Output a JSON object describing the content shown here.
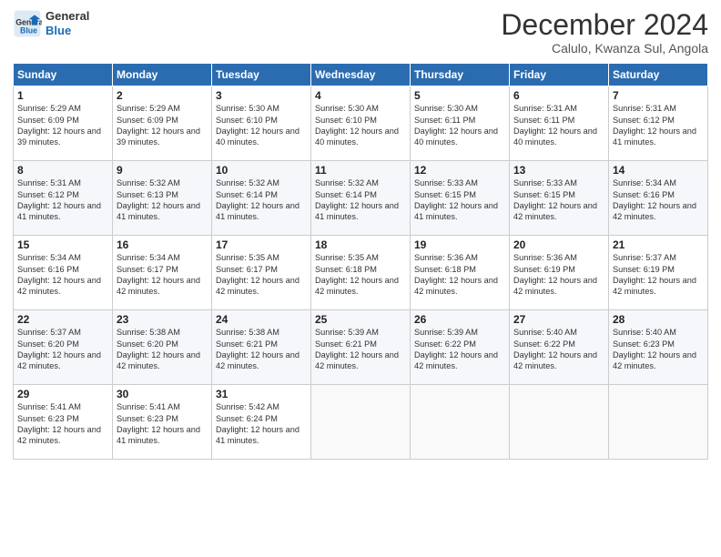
{
  "logo": {
    "line1": "General",
    "line2": "Blue"
  },
  "title": "December 2024",
  "subtitle": "Calulo, Kwanza Sul, Angola",
  "days_header": [
    "Sunday",
    "Monday",
    "Tuesday",
    "Wednesday",
    "Thursday",
    "Friday",
    "Saturday"
  ],
  "weeks": [
    [
      {
        "day": "1",
        "sunrise": "5:29 AM",
        "sunset": "6:09 PM",
        "daylight": "12 hours and 39 minutes."
      },
      {
        "day": "2",
        "sunrise": "5:29 AM",
        "sunset": "6:09 PM",
        "daylight": "12 hours and 39 minutes."
      },
      {
        "day": "3",
        "sunrise": "5:30 AM",
        "sunset": "6:10 PM",
        "daylight": "12 hours and 40 minutes."
      },
      {
        "day": "4",
        "sunrise": "5:30 AM",
        "sunset": "6:10 PM",
        "daylight": "12 hours and 40 minutes."
      },
      {
        "day": "5",
        "sunrise": "5:30 AM",
        "sunset": "6:11 PM",
        "daylight": "12 hours and 40 minutes."
      },
      {
        "day": "6",
        "sunrise": "5:31 AM",
        "sunset": "6:11 PM",
        "daylight": "12 hours and 40 minutes."
      },
      {
        "day": "7",
        "sunrise": "5:31 AM",
        "sunset": "6:12 PM",
        "daylight": "12 hours and 41 minutes."
      }
    ],
    [
      {
        "day": "8",
        "sunrise": "5:31 AM",
        "sunset": "6:12 PM",
        "daylight": "12 hours and 41 minutes."
      },
      {
        "day": "9",
        "sunrise": "5:32 AM",
        "sunset": "6:13 PM",
        "daylight": "12 hours and 41 minutes."
      },
      {
        "day": "10",
        "sunrise": "5:32 AM",
        "sunset": "6:14 PM",
        "daylight": "12 hours and 41 minutes."
      },
      {
        "day": "11",
        "sunrise": "5:32 AM",
        "sunset": "6:14 PM",
        "daylight": "12 hours and 41 minutes."
      },
      {
        "day": "12",
        "sunrise": "5:33 AM",
        "sunset": "6:15 PM",
        "daylight": "12 hours and 41 minutes."
      },
      {
        "day": "13",
        "sunrise": "5:33 AM",
        "sunset": "6:15 PM",
        "daylight": "12 hours and 42 minutes."
      },
      {
        "day": "14",
        "sunrise": "5:34 AM",
        "sunset": "6:16 PM",
        "daylight": "12 hours and 42 minutes."
      }
    ],
    [
      {
        "day": "15",
        "sunrise": "5:34 AM",
        "sunset": "6:16 PM",
        "daylight": "12 hours and 42 minutes."
      },
      {
        "day": "16",
        "sunrise": "5:34 AM",
        "sunset": "6:17 PM",
        "daylight": "12 hours and 42 minutes."
      },
      {
        "day": "17",
        "sunrise": "5:35 AM",
        "sunset": "6:17 PM",
        "daylight": "12 hours and 42 minutes."
      },
      {
        "day": "18",
        "sunrise": "5:35 AM",
        "sunset": "6:18 PM",
        "daylight": "12 hours and 42 minutes."
      },
      {
        "day": "19",
        "sunrise": "5:36 AM",
        "sunset": "6:18 PM",
        "daylight": "12 hours and 42 minutes."
      },
      {
        "day": "20",
        "sunrise": "5:36 AM",
        "sunset": "6:19 PM",
        "daylight": "12 hours and 42 minutes."
      },
      {
        "day": "21",
        "sunrise": "5:37 AM",
        "sunset": "6:19 PM",
        "daylight": "12 hours and 42 minutes."
      }
    ],
    [
      {
        "day": "22",
        "sunrise": "5:37 AM",
        "sunset": "6:20 PM",
        "daylight": "12 hours and 42 minutes."
      },
      {
        "day": "23",
        "sunrise": "5:38 AM",
        "sunset": "6:20 PM",
        "daylight": "12 hours and 42 minutes."
      },
      {
        "day": "24",
        "sunrise": "5:38 AM",
        "sunset": "6:21 PM",
        "daylight": "12 hours and 42 minutes."
      },
      {
        "day": "25",
        "sunrise": "5:39 AM",
        "sunset": "6:21 PM",
        "daylight": "12 hours and 42 minutes."
      },
      {
        "day": "26",
        "sunrise": "5:39 AM",
        "sunset": "6:22 PM",
        "daylight": "12 hours and 42 minutes."
      },
      {
        "day": "27",
        "sunrise": "5:40 AM",
        "sunset": "6:22 PM",
        "daylight": "12 hours and 42 minutes."
      },
      {
        "day": "28",
        "sunrise": "5:40 AM",
        "sunset": "6:23 PM",
        "daylight": "12 hours and 42 minutes."
      }
    ],
    [
      {
        "day": "29",
        "sunrise": "5:41 AM",
        "sunset": "6:23 PM",
        "daylight": "12 hours and 42 minutes."
      },
      {
        "day": "30",
        "sunrise": "5:41 AM",
        "sunset": "6:23 PM",
        "daylight": "12 hours and 41 minutes."
      },
      {
        "day": "31",
        "sunrise": "5:42 AM",
        "sunset": "6:24 PM",
        "daylight": "12 hours and 41 minutes."
      },
      null,
      null,
      null,
      null
    ]
  ]
}
